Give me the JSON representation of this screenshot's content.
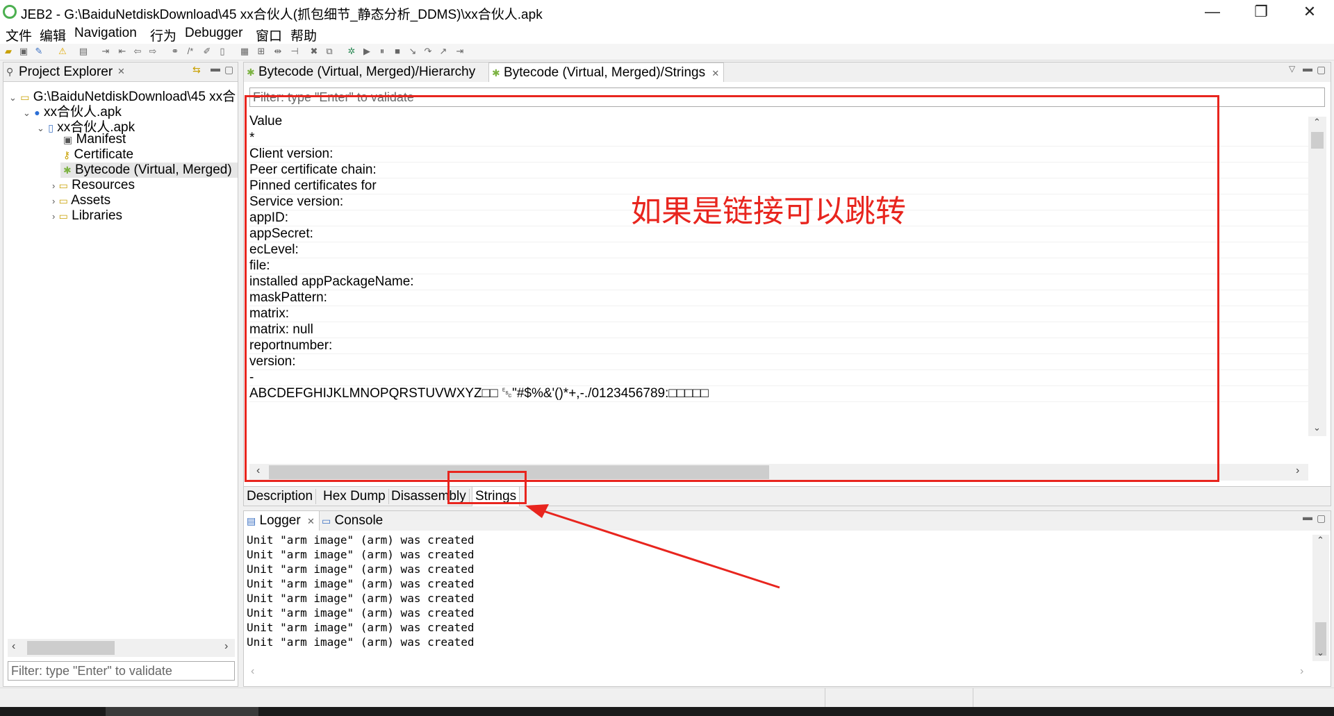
{
  "window": {
    "title": "JEB2 - G:\\BaiduNetdiskDownload\\45 xx合伙人(抓包细节_静态分析_DDMS)\\xx合伙人.apk"
  },
  "menu": [
    "文件",
    "编辑",
    "Navigation",
    "行为",
    "Debugger",
    "窗口",
    "帮助"
  ],
  "explorer": {
    "title": "Project Explorer",
    "tree": [
      {
        "label": "G:\\BaiduNetdiskDownload\\45 xx合",
        "icon": "folder-icon"
      },
      {
        "label": "xx合伙人.apk",
        "icon": "apk-icon"
      },
      {
        "label": "xx合伙人.apk",
        "icon": "package-icon"
      },
      {
        "label": "Manifest",
        "icon": "manifest-icon"
      },
      {
        "label": "Certificate",
        "icon": "key-icon"
      },
      {
        "label": "Bytecode (Virtual, Merged)",
        "icon": "android-icon"
      },
      {
        "label": "Resources",
        "icon": "folder-icon"
      },
      {
        "label": "Assets",
        "icon": "folder-icon"
      },
      {
        "label": "Libraries",
        "icon": "folder-icon"
      }
    ],
    "filter_placeholder": "Filter: type \"Enter\" to validate"
  },
  "editor": {
    "tabs": [
      "Bytecode (Virtual, Merged)/Hierarchy",
      "Bytecode (Virtual, Merged)/Strings"
    ],
    "filter_placeholder": "Filter: type \"Enter\" to validate",
    "column_header": "Value",
    "rows": [
      "  *",
      " Client version:",
      " Peer certificate chain:",
      " Pinned certificates for",
      " Service version:",
      "appID:",
      "appSecret:",
      "ecLevel:",
      "file:",
      "installed appPackageName:",
      "maskPattern:",
      "matrix:",
      "matrix: null",
      "reportnumber:",
      "version:",
      "-",
      "ABCDEFGHIJKLMNOPQRSTUVWXYZ□□ ␛\"#$%&'()*+,-./0123456789:□□□□□"
    ],
    "bottom_tabs": [
      "Description",
      "Hex Dump",
      "Disassembly",
      "Strings"
    ]
  },
  "annotation": {
    "text": "如果是链接可以跳转",
    "color": "#e8251e"
  },
  "console": {
    "tabs": [
      "Logger",
      "Console"
    ],
    "lines": [
      "Unit \"arm image\" (arm) was created",
      "Unit \"arm image\" (arm) was created",
      "Unit \"arm image\" (arm) was created",
      "Unit \"arm image\" (arm) was created",
      "Unit \"arm image\" (arm) was created",
      "Unit \"arm image\" (arm) was created",
      "Unit \"arm image\" (arm) was created",
      "Unit \"arm image\" (arm) was created"
    ]
  }
}
